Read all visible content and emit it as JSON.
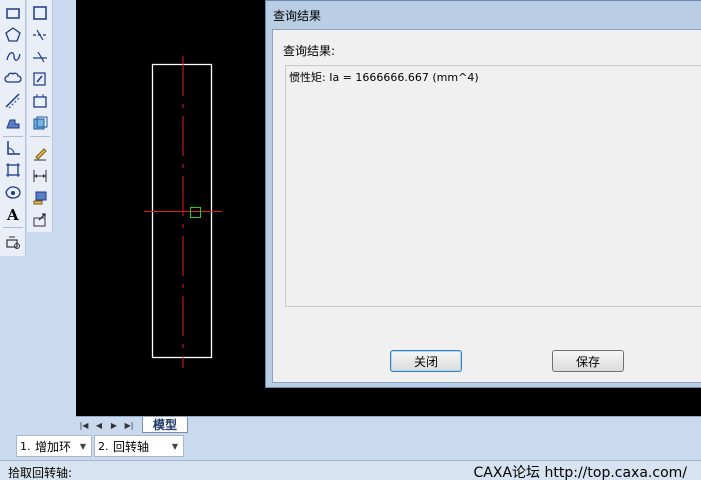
{
  "dialog": {
    "title": "查询结果",
    "result_label": "查询结果:",
    "result_text": "惯性矩: Ia = 1666666.667 (mm^4)",
    "close_label": "关闭",
    "save_label": "保存"
  },
  "tabs": {
    "model_tab": "模型"
  },
  "immediate_menu": {
    "field1_num": "1.",
    "field1_value": "增加环",
    "field2_num": "2.",
    "field2_value": "回转轴"
  },
  "status": {
    "prompt": "拾取回转轴:",
    "watermark": "CAXA论坛 http://top.caxa.com/"
  },
  "toolbar_left": [
    "rectangle-icon",
    "polygon-icon",
    "spline-icon",
    "cloud-icon",
    "offset-icon",
    "hatch-icon",
    "angle-icon",
    "boundary-icon",
    "region-icon",
    "text-icon",
    "block-icon"
  ],
  "toolbar_right": [
    "frame-icon",
    "break-icon",
    "extend-icon",
    "insert-icon",
    "box-icon",
    "measure-icon",
    "pen-icon",
    "dimension-icon",
    "stamp-icon",
    "export-icon"
  ],
  "colors": {
    "canvas": "#000000",
    "centerline": "#e11d1d",
    "outline": "#ffffff",
    "pick_box": "#22cc22"
  }
}
